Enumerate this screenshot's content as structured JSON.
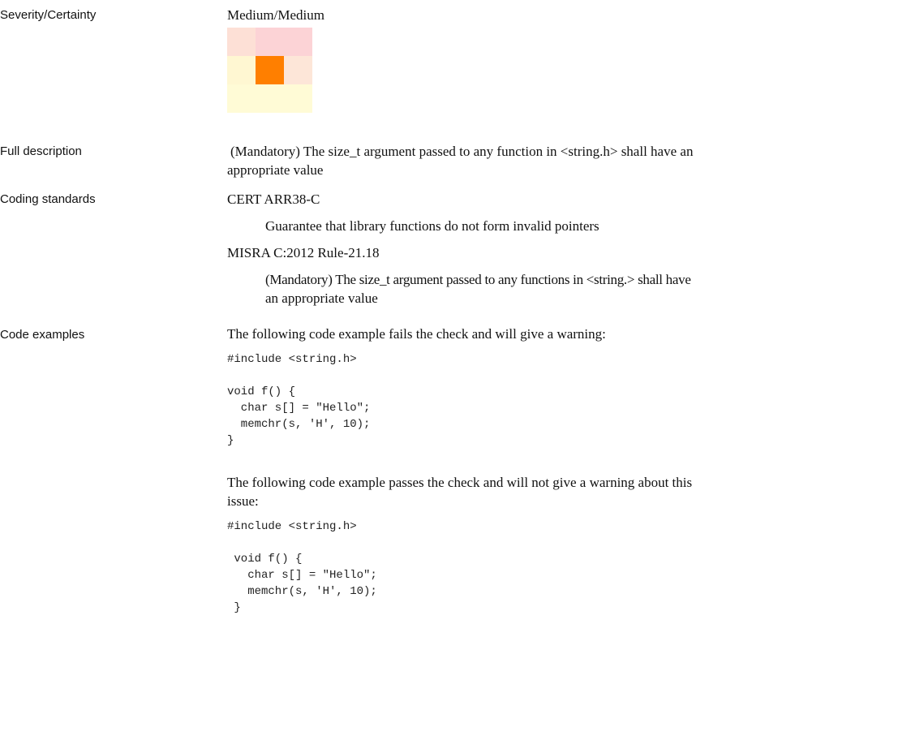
{
  "rows": {
    "severity": {
      "label": "Severity/Certainty",
      "value": "Medium/Medium"
    },
    "description": {
      "label": "Full description",
      "line1": "(Mandatory) The size_t argument passed to any function in <string.h> shall have an",
      "line2": "appropriate value"
    },
    "coding": {
      "label": "Coding standards",
      "std1_name": "CERT ARR38-C",
      "std1_text": "Guarantee that library functions do not form invalid pointers",
      "std2_name": "MISRA C:2012 Rule-21.18",
      "std2_text1": "(Mandatory) The size_t argument passed to any functions in <string.> shall have",
      "std2_text2": "an appropriate value"
    },
    "examples": {
      "label": "Code examples",
      "fail_intro": "The following code example fails the check and will give a warning:",
      "fail_code": "#include <string.h>\n\nvoid f() {\n  char s[] = \"Hello\";\n  memchr(s, 'H', 10);\n}",
      "pass_intro1": "The following code example passes the check and will not give a warning about this",
      "pass_intro2": "issue:",
      "pass_code": "#include <string.h>\n\n void f() {\n   char s[] = \"Hello\";\n   memchr(s, 'H', 10);\n }"
    }
  },
  "severity_matrix": {
    "colors": [
      [
        "#fde0d6",
        "#fcd3d6",
        "#fcd3d6"
      ],
      [
        "#fff7d2",
        "#ff7f00",
        "#fde6d8"
      ],
      [
        "#fffbd6",
        "#fffbd6",
        "#fffbd6"
      ]
    ]
  }
}
